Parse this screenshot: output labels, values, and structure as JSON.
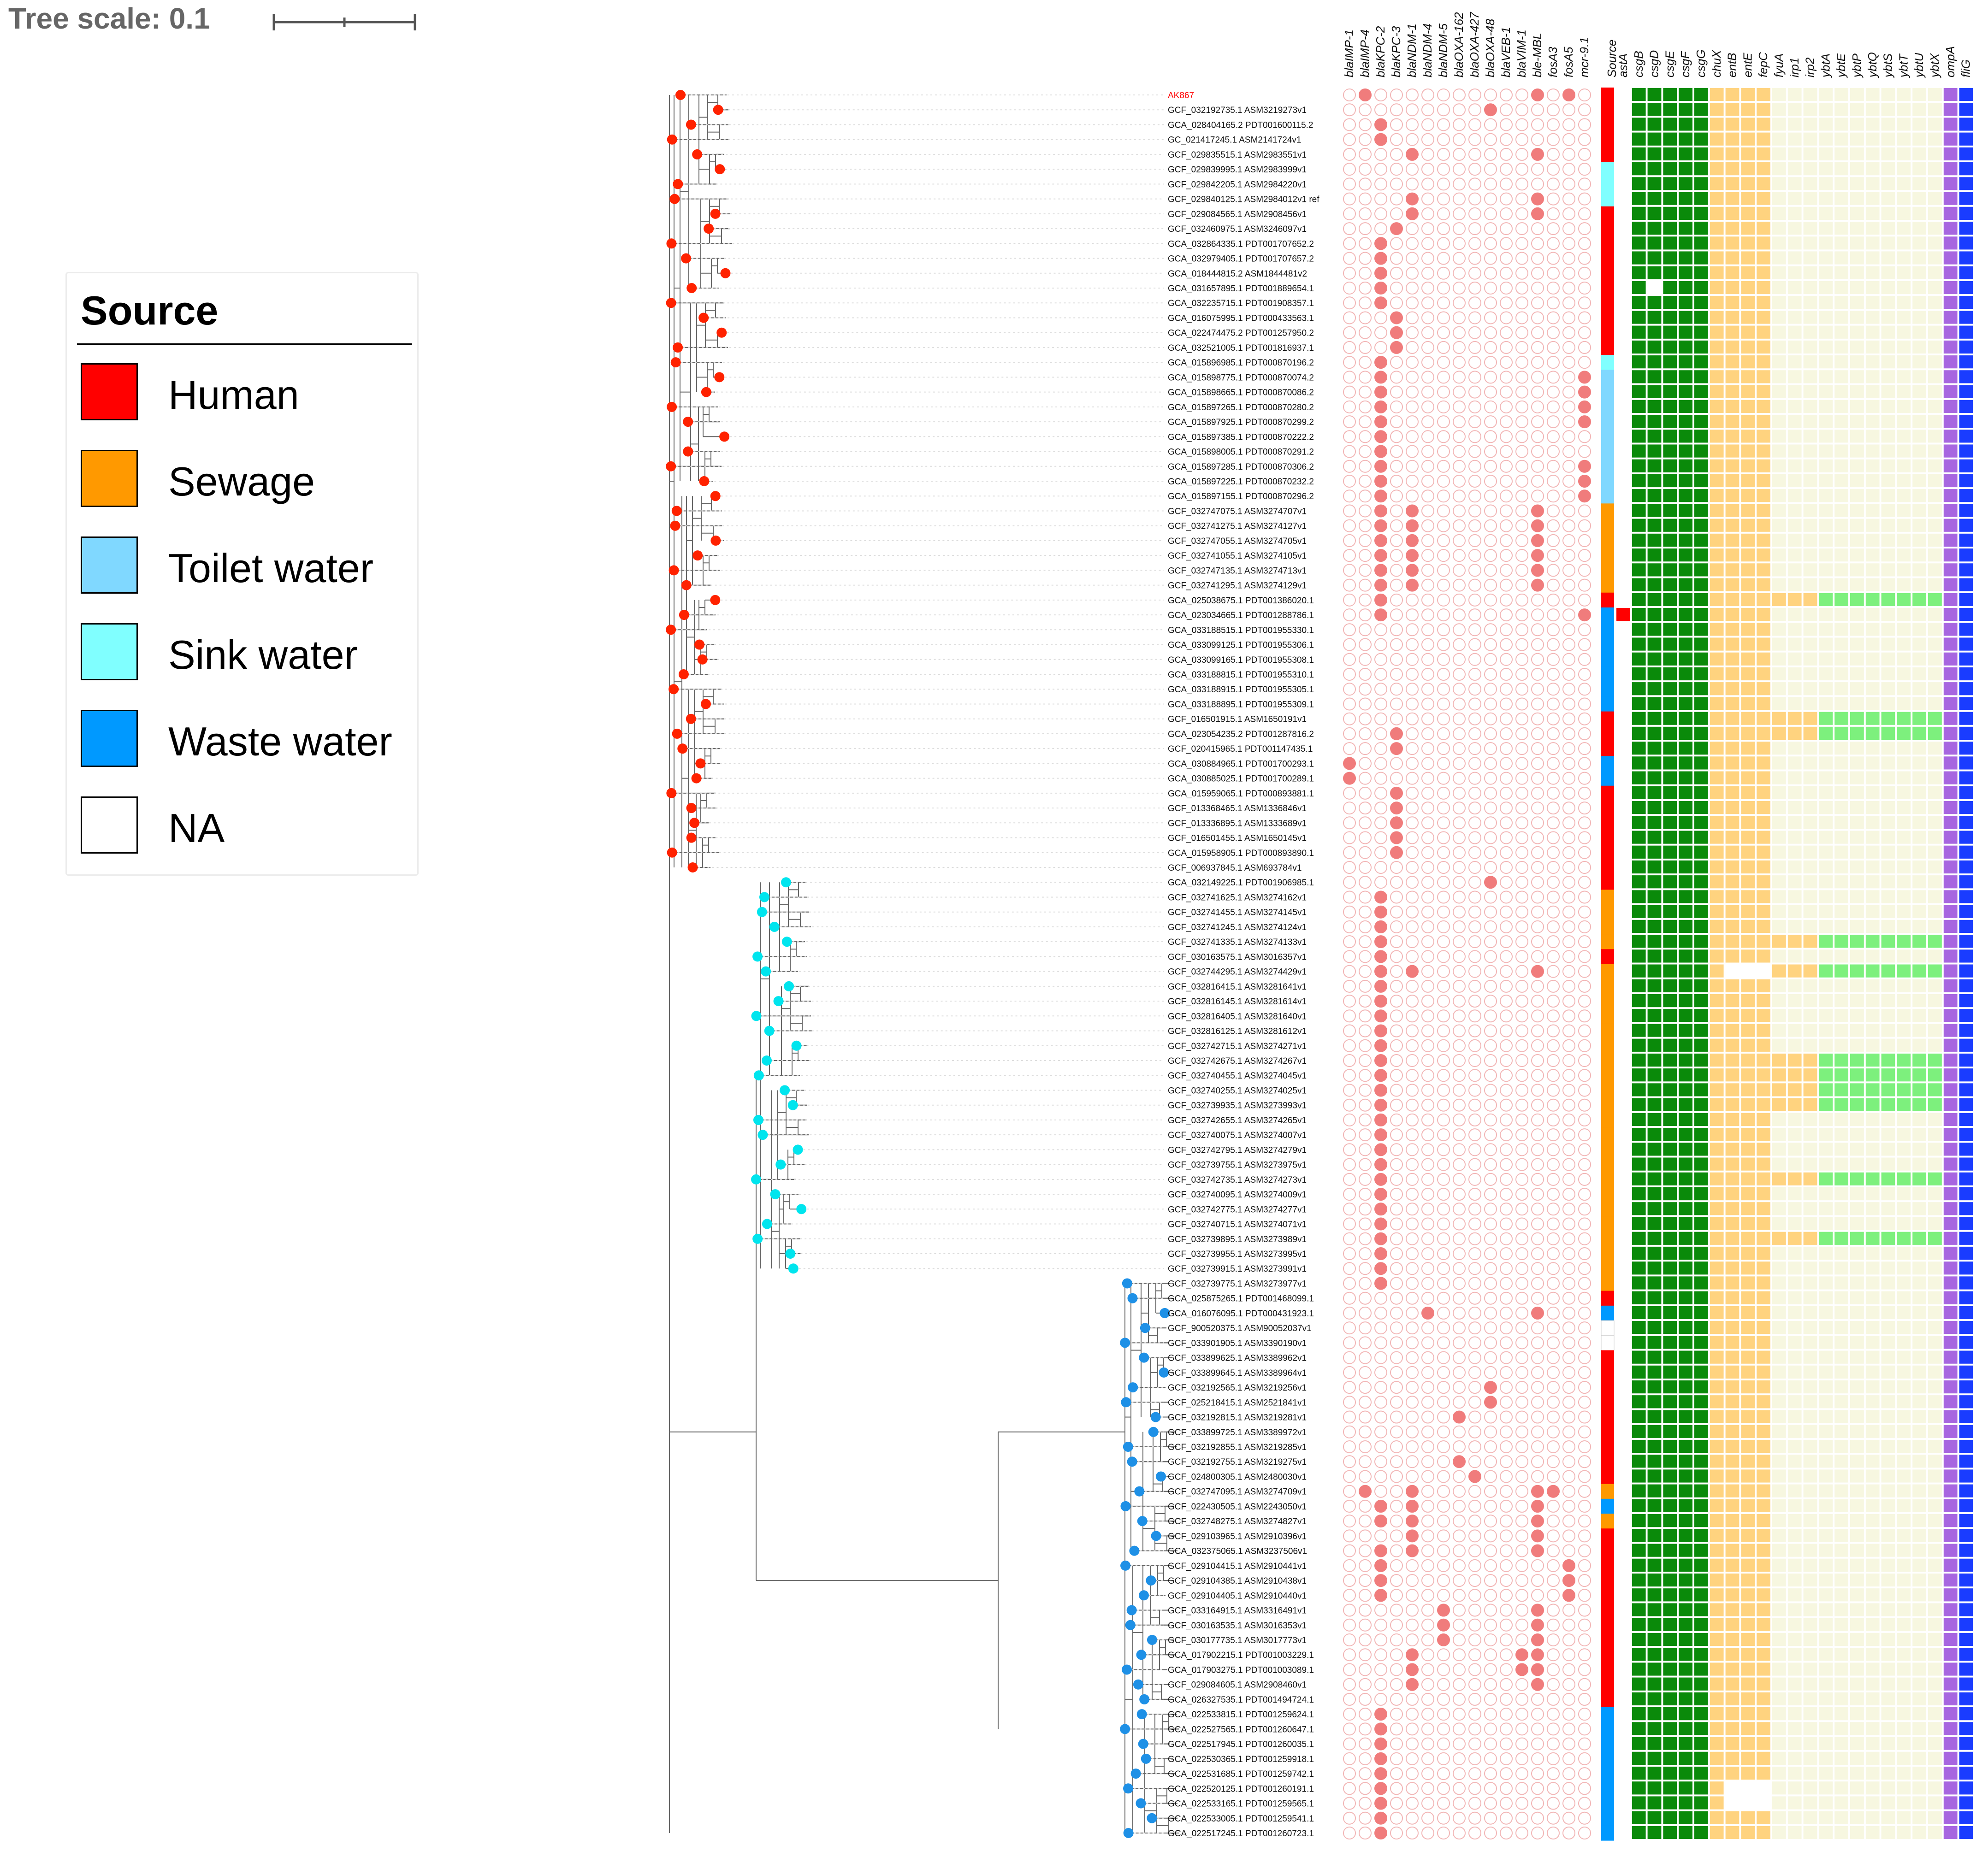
{
  "scale": {
    "label": "Tree scale: 0.1"
  },
  "legend": {
    "title": "Source",
    "items": [
      {
        "label": "Human",
        "color": "#ff0000"
      },
      {
        "label": "Sewage",
        "color": "#ff9900"
      },
      {
        "label": "Toilet water",
        "color": "#80d8ff"
      },
      {
        "label": "Sink water",
        "color": "#80ffff"
      },
      {
        "label": "Waste water",
        "color": "#0099ff"
      },
      {
        "label": "NA",
        "color": "#ffffff"
      }
    ]
  },
  "colors": {
    "tip_red": "#ff2200",
    "tip_cyan": "#00e5ee",
    "tip_blue": "#1e90e6",
    "amr_fill": "#f07c7c",
    "amr_empty": "#f2b6b6",
    "csg": "#0a8a0a",
    "ent": "#ffd37f",
    "ybt": "#7df07d",
    "ybt_empty": "#f7f7e0",
    "ompA": "#a766e0",
    "fliG": "#1a3cff",
    "highlight_label": "#ff0000"
  },
  "amr_genes": [
    "blaIMP-1",
    "blaIMP-4",
    "blaKPC-2",
    "blaKPC-3",
    "blaNDM-1",
    "blaNDM-4",
    "blaNDM-5",
    "blaOXA-162",
    "blaOXA-427",
    "blaOXA-48",
    "blaVEB-1",
    "blaVIM-1",
    "ble-MBL",
    "fosA3",
    "fosA5",
    "mcr-9.1"
  ],
  "vir_genes": [
    "astA",
    "csgB",
    "csgD",
    "csgE",
    "csgF",
    "csgG",
    "chuX",
    "entB",
    "entE",
    "fepC",
    "fyuA",
    "irp1",
    "irp2",
    "ybtA",
    "ybtE",
    "ybtP",
    "ybtQ",
    "ybtS",
    "ybtT",
    "ybtU",
    "ybtX",
    "ompA",
    "fliG"
  ],
  "source_header": "Source",
  "taxa": [
    {
      "name": "AK867",
      "src": "H",
      "amr": [
        1,
        12,
        14
      ],
      "ybt": 0
    },
    {
      "name": "GCF_032192735.1 ASM3219273v1",
      "src": "H",
      "amr": [
        9
      ],
      "ybt": 0
    },
    {
      "name": "GCA_028404165.2 PDT001600115.2",
      "src": "H",
      "amr": [
        2
      ],
      "ybt": 0
    },
    {
      "name": "GC_021417245.1 ASM2141724v1",
      "src": "H",
      "amr": [
        2
      ],
      "ybt": 0
    },
    {
      "name": "GCF_029835515.1 ASM2983551v1",
      "src": "H",
      "amr": [
        4,
        12
      ],
      "ybt": 0
    },
    {
      "name": "GCF_029839995.1 ASM2983999v1",
      "src": "K",
      "amr": [],
      "ybt": 0
    },
    {
      "name": "GCF_029842205.1 ASM2984220v1",
      "src": "K",
      "amr": [],
      "ybt": 0
    },
    {
      "name": "GCF_029840125.1 ASM2984012v1 ref",
      "src": "K",
      "amr": [
        4,
        12
      ],
      "ybt": 0
    },
    {
      "name": "GCF_029084565.1 ASM2908456v1",
      "src": "H",
      "amr": [
        4,
        12
      ],
      "ybt": 0
    },
    {
      "name": "GCF_032460975.1 ASM3246097v1",
      "src": "H",
      "amr": [
        3
      ],
      "ybt": 0
    },
    {
      "name": "GCA_032864335.1 PDT001707652.2",
      "src": "H",
      "amr": [
        2
      ],
      "ybt": 0
    },
    {
      "name": "GCA_032979405.1 PDT001707657.2",
      "src": "H",
      "amr": [
        2
      ],
      "ybt": 0
    },
    {
      "name": "GCA_018444815.2 ASM1844481v2",
      "src": "H",
      "amr": [
        2
      ],
      "ybt": 0
    },
    {
      "name": "GCA_031657895.1 PDT001889654.1",
      "src": "H",
      "amr": [
        2
      ],
      "ybt": 0,
      "csgWhite": 1
    },
    {
      "name": "GCA_032235715.1 PDT001908357.1",
      "src": "H",
      "amr": [
        2
      ],
      "ybt": 0
    },
    {
      "name": "GCA_016075995.1 PDT000433563.1",
      "src": "H",
      "amr": [
        3
      ],
      "ybt": 0
    },
    {
      "name": "GCA_022474475.2 PDT001257950.2",
      "src": "H",
      "amr": [
        3
      ],
      "ybt": 0
    },
    {
      "name": "GCA_032521005.1 PDT001816937.1",
      "src": "H",
      "amr": [
        3
      ],
      "ybt": 0
    },
    {
      "name": "GCA_015896985.1 PDT000870196.2",
      "src": "K",
      "amr": [
        2
      ],
      "ybt": 0
    },
    {
      "name": "GCA_015898775.1 PDT000870074.2",
      "src": "T",
      "amr": [
        2,
        15
      ],
      "ybt": 0
    },
    {
      "name": "GCA_015898665.1 PDT000870086.2",
      "src": "T",
      "amr": [
        2,
        15
      ],
      "ybt": 0
    },
    {
      "name": "GCA_015897265.1 PDT000870280.2",
      "src": "T",
      "amr": [
        2,
        15
      ],
      "ybt": 0
    },
    {
      "name": "GCA_015897925.1 PDT000870299.2",
      "src": "T",
      "amr": [
        2,
        15
      ],
      "ybt": 0
    },
    {
      "name": "GCA_015897385.1 PDT000870222.2",
      "src": "T",
      "amr": [
        2
      ],
      "ybt": 0
    },
    {
      "name": "GCA_015898005.1 PDT000870291.2",
      "src": "T",
      "amr": [
        2
      ],
      "ybt": 0
    },
    {
      "name": "GCA_015897285.1 PDT000870306.2",
      "src": "T",
      "amr": [
        2,
        15
      ],
      "ybt": 0
    },
    {
      "name": "GCA_015897225.1 PDT000870232.2",
      "src": "T",
      "amr": [
        2,
        15
      ],
      "ybt": 0
    },
    {
      "name": "GCA_015897155.1 PDT000870296.2",
      "src": "T",
      "amr": [
        2,
        15
      ],
      "ybt": 0
    },
    {
      "name": "GCF_032747075.1 ASM3274707v1",
      "src": "S",
      "amr": [
        2,
        4,
        12
      ],
      "ybt": 0
    },
    {
      "name": "GCF_032741275.1 ASM3274127v1",
      "src": "S",
      "amr": [
        2,
        4,
        12
      ],
      "ybt": 0
    },
    {
      "name": "GCF_032747055.1 ASM3274705v1",
      "src": "S",
      "amr": [
        2,
        4,
        12
      ],
      "ybt": 0
    },
    {
      "name": "GCF_032741055.1 ASM3274105v1",
      "src": "S",
      "amr": [
        2,
        4,
        12
      ],
      "ybt": 0
    },
    {
      "name": "GCF_032747135.1 ASM3274713v1",
      "src": "S",
      "amr": [
        2,
        4,
        12
      ],
      "ybt": 0
    },
    {
      "name": "GCF_032741295.1 ASM3274129v1",
      "src": "S",
      "amr": [
        2,
        4,
        12
      ],
      "ybt": 0
    },
    {
      "name": "GCA_025038675.1 PDT001386020.1",
      "src": "H",
      "amr": [
        2
      ],
      "ybt": 1
    },
    {
      "name": "GCA_023034665.1 PDT001288786.1",
      "src": "W",
      "amr": [
        2,
        15
      ],
      "ybt": 0,
      "astA": 1
    },
    {
      "name": "GCA_033188515.1 PDT001955330.1",
      "src": "W",
      "amr": [],
      "ybt": 0
    },
    {
      "name": "GCA_033099125.1 PDT001955306.1",
      "src": "W",
      "amr": [],
      "ybt": 0
    },
    {
      "name": "GCA_033099165.1 PDT001955308.1",
      "src": "W",
      "amr": [],
      "ybt": 0
    },
    {
      "name": "GCA_033188815.1 PDT001955310.1",
      "src": "W",
      "amr": [],
      "ybt": 0
    },
    {
      "name": "GCA_033188915.1 PDT001955305.1",
      "src": "W",
      "amr": [],
      "ybt": 0
    },
    {
      "name": "GCA_033188895.1 PDT001955309.1",
      "src": "W",
      "amr": [],
      "ybt": 0
    },
    {
      "name": "GCF_016501915.1 ASM1650191v1",
      "src": "H",
      "amr": [],
      "ybt": 1
    },
    {
      "name": "GCA_023054235.2 PDT001287816.2",
      "src": "H",
      "amr": [
        3
      ],
      "ybt": 1
    },
    {
      "name": "GCF_020415965.1 PDT001147435.1",
      "src": "H",
      "amr": [
        3
      ],
      "ybt": 0
    },
    {
      "name": "GCA_030884965.1 PDT001700293.1",
      "src": "W",
      "amr": [
        0
      ],
      "ybt": 0
    },
    {
      "name": "GCA_030885025.1 PDT001700289.1",
      "src": "W",
      "amr": [
        0
      ],
      "ybt": 0
    },
    {
      "name": "GCA_015959065.1 PDT000893881.1",
      "src": "H",
      "amr": [
        3
      ],
      "ybt": 0
    },
    {
      "name": "GCF_013368465.1 ASM1336846v1",
      "src": "H",
      "amr": [
        3
      ],
      "ybt": 0
    },
    {
      "name": "GCF_013336895.1 ASM1333689v1",
      "src": "H",
      "amr": [
        3
      ],
      "ybt": 0
    },
    {
      "name": "GCF_016501455.1 ASM1650145v1",
      "src": "H",
      "amr": [
        3
      ],
      "ybt": 0
    },
    {
      "name": "GCA_015958905.1 PDT000893890.1",
      "src": "H",
      "amr": [
        3
      ],
      "ybt": 0
    },
    {
      "name": "GCF_006937845.1 ASM693784v1",
      "src": "H",
      "amr": [],
      "ybt": 0
    },
    {
      "name": "GCA_032149225.1 PDT001906985.1",
      "src": "H",
      "amr": [
        9
      ],
      "ybt": 0
    },
    {
      "name": "GCF_032741625.1 ASM3274162v1",
      "src": "S",
      "amr": [
        2
      ],
      "ybt": 0
    },
    {
      "name": "GCF_032741455.1 ASM3274145v1",
      "src": "S",
      "amr": [
        2
      ],
      "ybt": 0
    },
    {
      "name": "GCF_032741245.1 ASM3274124v1",
      "src": "S",
      "amr": [
        2
      ],
      "ybt": 0
    },
    {
      "name": "GCF_032741335.1 ASM3274133v1",
      "src": "S",
      "amr": [
        2
      ],
      "ybt": 1
    },
    {
      "name": "GCF_030163575.1 ASM3016357v1",
      "src": "H",
      "amr": [
        2
      ],
      "ybt": 0
    },
    {
      "name": "GCF_032744295.1 ASM3274429v1",
      "src": "S",
      "amr": [
        2,
        4,
        12
      ],
      "ybt": 1,
      "entWhite": 1
    },
    {
      "name": "GCF_032816415.1 ASM3281641v1",
      "src": "S",
      "amr": [
        2
      ],
      "ybt": 0
    },
    {
      "name": "GCF_032816145.1 ASM3281614v1",
      "src": "S",
      "amr": [
        2
      ],
      "ybt": 0
    },
    {
      "name": "GCF_032816405.1 ASM3281640v1",
      "src": "S",
      "amr": [
        2
      ],
      "ybt": 0
    },
    {
      "name": "GCF_032816125.1 ASM3281612v1",
      "src": "S",
      "amr": [
        2
      ],
      "ybt": 0
    },
    {
      "name": "GCF_032742715.1 ASM3274271v1",
      "src": "S",
      "amr": [
        2
      ],
      "ybt": 0
    },
    {
      "name": "GCF_032742675.1 ASM3274267v1",
      "src": "S",
      "amr": [
        2
      ],
      "ybt": 1
    },
    {
      "name": "GCF_032740455.1 ASM3274045v1",
      "src": "S",
      "amr": [
        2
      ],
      "ybt": 1
    },
    {
      "name": "GCF_032740255.1 ASM3274025v1",
      "src": "S",
      "amr": [
        2
      ],
      "ybt": 1
    },
    {
      "name": "GCF_032739935.1 ASM3273993v1",
      "src": "S",
      "amr": [
        2
      ],
      "ybt": 1
    },
    {
      "name": "GCF_032742655.1 ASM3274265v1",
      "src": "S",
      "amr": [
        2
      ],
      "ybt": 0
    },
    {
      "name": "GCF_032740075.1 ASM3274007v1",
      "src": "S",
      "amr": [
        2
      ],
      "ybt": 0
    },
    {
      "name": "GCF_032742795.1 ASM3274279v1",
      "src": "S",
      "amr": [
        2
      ],
      "ybt": 0
    },
    {
      "name": "GCF_032739755.1 ASM3273975v1",
      "src": "S",
      "amr": [
        2
      ],
      "ybt": 0
    },
    {
      "name": "GCF_032742735.1 ASM3274273v1",
      "src": "S",
      "amr": [
        2
      ],
      "ybt": 1
    },
    {
      "name": "GCF_032740095.1 ASM3274009v1",
      "src": "S",
      "amr": [
        2
      ],
      "ybt": 0
    },
    {
      "name": "GCF_032742775.1 ASM3274277v1",
      "src": "S",
      "amr": [
        2
      ],
      "ybt": 0
    },
    {
      "name": "GCF_032740715.1 ASM3274071v1",
      "src": "S",
      "amr": [
        2
      ],
      "ybt": 0
    },
    {
      "name": "GCF_032739895.1 ASM3273989v1",
      "src": "S",
      "amr": [
        2
      ],
      "ybt": 1
    },
    {
      "name": "GCF_032739955.1 ASM3273995v1",
      "src": "S",
      "amr": [
        2
      ],
      "ybt": 0
    },
    {
      "name": "GCF_032739915.1 ASM3273991v1",
      "src": "S",
      "amr": [
        2
      ],
      "ybt": 0
    },
    {
      "name": "GCF_032739775.1 ASM3273977v1",
      "src": "S",
      "amr": [
        2
      ],
      "ybt": 0
    },
    {
      "name": "GCA_025875265.1 PDT001468099.1",
      "src": "H",
      "amr": [],
      "ybt": 0
    },
    {
      "name": "GCA_016076095.1 PDT000431923.1",
      "src": "W",
      "amr": [
        5,
        12
      ],
      "ybt": 0
    },
    {
      "name": "GCF_900520375.1 ASM90052037v1",
      "src": "N",
      "amr": [],
      "ybt": 0
    },
    {
      "name": "GCF_033901905.1 ASM3390190v1",
      "src": "N",
      "amr": [],
      "ybt": 0
    },
    {
      "name": "GCF_033899625.1 ASM3389962v1",
      "src": "H",
      "amr": [],
      "ybt": 0
    },
    {
      "name": "GCF_033899645.1 ASM3389964v1",
      "src": "H",
      "amr": [],
      "ybt": 0
    },
    {
      "name": "GCF_032192565.1 ASM3219256v1",
      "src": "H",
      "amr": [
        9
      ],
      "ybt": 0
    },
    {
      "name": "GCF_025218415.1 ASM2521841v1",
      "src": "H",
      "amr": [
        9
      ],
      "ybt": 0
    },
    {
      "name": "GCF_032192815.1 ASM3219281v1",
      "src": "H",
      "amr": [
        7
      ],
      "ybt": 0
    },
    {
      "name": "GCF_033899725.1 ASM3389972v1",
      "src": "H",
      "amr": [],
      "ybt": 0
    },
    {
      "name": "GCF_032192855.1 ASM3219285v1",
      "src": "H",
      "amr": [],
      "ybt": 0
    },
    {
      "name": "GCF_032192755.1 ASM3219275v1",
      "src": "H",
      "amr": [
        7
      ],
      "ybt": 0
    },
    {
      "name": "GCF_024800305.1 ASM2480030v1",
      "src": "H",
      "amr": [
        8
      ],
      "ybt": 0
    },
    {
      "name": "GCF_032747095.1 ASM3274709v1",
      "src": "S",
      "amr": [
        1,
        4,
        12,
        13
      ],
      "ybt": 0
    },
    {
      "name": "GCF_022430505.1 ASM2243050v1",
      "src": "W",
      "amr": [
        2,
        4,
        12
      ],
      "ybt": 0
    },
    {
      "name": "GCF_032748275.1 ASM3274827v1",
      "src": "S",
      "amr": [
        2,
        4,
        12
      ],
      "ybt": 0
    },
    {
      "name": "GCF_029103965.1 ASM2910396v1",
      "src": "H",
      "amr": [
        4,
        12
      ],
      "ybt": 0
    },
    {
      "name": "GCA_032375065.1 ASM3237506v1",
      "src": "H",
      "amr": [
        2,
        4,
        12
      ],
      "ybt": 0
    },
    {
      "name": "GCF_029104415.1 ASM2910441v1",
      "src": "H",
      "amr": [
        2,
        14
      ],
      "ybt": 0
    },
    {
      "name": "GCF_029104385.1 ASM2910438v1",
      "src": "H",
      "amr": [
        2,
        14
      ],
      "ybt": 0
    },
    {
      "name": "GCF_029104405.1 ASM2910440v1",
      "src": "H",
      "amr": [
        2,
        14
      ],
      "ybt": 0
    },
    {
      "name": "GCF_033164915.1 ASM3316491v1",
      "src": "H",
      "amr": [
        6,
        12
      ],
      "ybt": 0
    },
    {
      "name": "GCF_030163535.1 ASM3016353v1",
      "src": "H",
      "amr": [
        6,
        12
      ],
      "ybt": 0
    },
    {
      "name": "GCF_030177735.1 ASM3017773v1",
      "src": "H",
      "amr": [
        6,
        12
      ],
      "ybt": 0
    },
    {
      "name": "GCA_017902215.1 PDT001003229.1",
      "src": "H",
      "amr": [
        4,
        11,
        12
      ],
      "ybt": 0
    },
    {
      "name": "GCA_017903275.1 PDT001003089.1",
      "src": "H",
      "amr": [
        4,
        11,
        12
      ],
      "ybt": 0
    },
    {
      "name": "GCF_029084605.1 ASM2908460v1",
      "src": "H",
      "amr": [
        4,
        12
      ],
      "ybt": 0
    },
    {
      "name": "GCA_026327535.1 PDT001494724.1",
      "src": "H",
      "amr": [],
      "ybt": 0
    },
    {
      "name": "GCA_022533815.1 PDT001259624.1",
      "src": "W",
      "amr": [
        2
      ],
      "ybt": 0
    },
    {
      "name": "GCA_022527565.1 PDT001260647.1",
      "src": "W",
      "amr": [
        2
      ],
      "ybt": 0
    },
    {
      "name": "GCA_022517945.1 PDT001260035.1",
      "src": "W",
      "amr": [
        2
      ],
      "ybt": 0
    },
    {
      "name": "GCA_022530365.1 PDT001259918.1",
      "src": "W",
      "amr": [
        2
      ],
      "ybt": 0
    },
    {
      "name": "GCA_022531685.1 PDT001259742.1",
      "src": "W",
      "amr": [
        2
      ],
      "ybt": 0
    },
    {
      "name": "GCA_022520125.1 PDT001260191.1",
      "src": "W",
      "amr": [
        2
      ],
      "ybt": 0,
      "entWhite": 1
    },
    {
      "name": "GCA_022533165.1 PDT001259565.1",
      "src": "W",
      "amr": [
        2
      ],
      "ybt": 0,
      "entWhite": 1
    },
    {
      "name": "GCA_022533005.1 PDT001259541.1",
      "src": "W",
      "amr": [
        2
      ],
      "ybt": 0
    },
    {
      "name": "GCA_022517245.1 PDT001260723.1",
      "src": "W",
      "amr": [
        2
      ],
      "ybt": 0
    }
  ]
}
